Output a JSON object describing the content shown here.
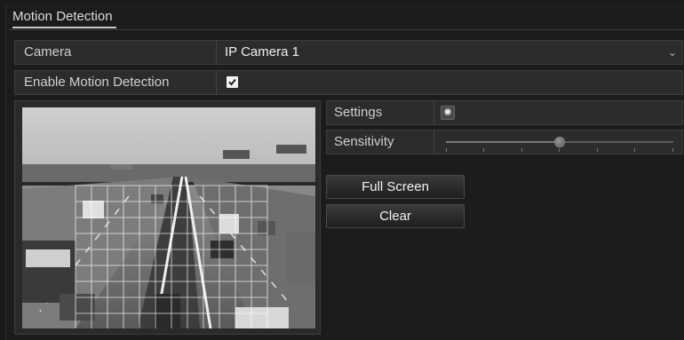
{
  "header": {
    "title": "Motion Detection"
  },
  "camera": {
    "label": "Camera",
    "value": "IP Camera 1",
    "dropdown_icon": "chevron-down-icon"
  },
  "enable": {
    "label": "Enable Motion Detection",
    "checked": true
  },
  "settings": {
    "label": "Settings",
    "icon": "gear-icon"
  },
  "sensitivity": {
    "label": "Sensitivity",
    "level_fraction": 0.5
  },
  "buttons": {
    "full_screen": "Full Screen",
    "clear": "Clear"
  },
  "preview": {
    "description_icon": "camera-preview",
    "grid_columns": 11,
    "grid_rows": 9
  }
}
